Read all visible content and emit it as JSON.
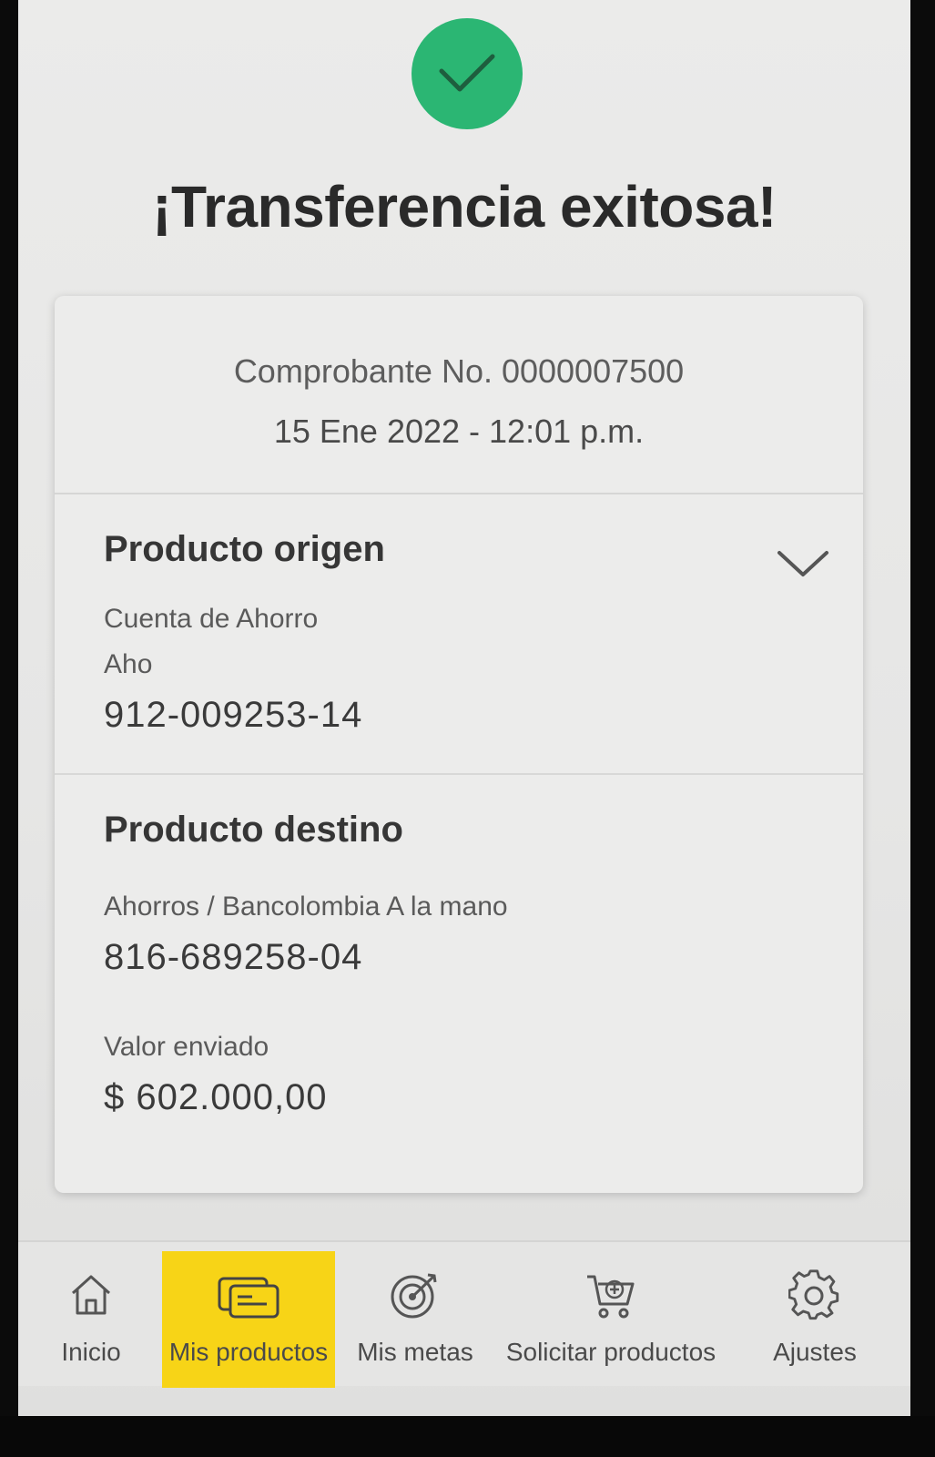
{
  "header": {
    "title": "¡Transferencia exitosa!",
    "status_icon": "check-icon",
    "status_color": "#2bb673"
  },
  "receipt": {
    "number_label": "Comprobante No. 0000007500",
    "datetime": "15 Ene 2022 - 12:01 p.m."
  },
  "origin": {
    "heading": "Producto origen",
    "account_type": "Cuenta de Ahorro",
    "account_alias": "Aho",
    "account_number": "912-009253-14",
    "toggle_icon": "chevron-down-icon"
  },
  "destination": {
    "heading": "Producto destino",
    "account_description": "Ahorros / Bancolombia A la mano",
    "account_number": "816-689258-04",
    "amount_label": "Valor enviado",
    "amount": "$ 602.000,00"
  },
  "tab_bar": {
    "active_color": "#f7d417",
    "active_tab": "Mis productos",
    "tabs": [
      {
        "label": "Inicio",
        "icon": "home-icon"
      },
      {
        "label": "Mis productos",
        "icon": "cards-icon"
      },
      {
        "label": "Mis metas",
        "icon": "target-icon"
      },
      {
        "label": "Solicitar productos",
        "icon": "cart-plus-icon"
      },
      {
        "label": "Ajustes",
        "icon": "gear-icon"
      }
    ]
  }
}
